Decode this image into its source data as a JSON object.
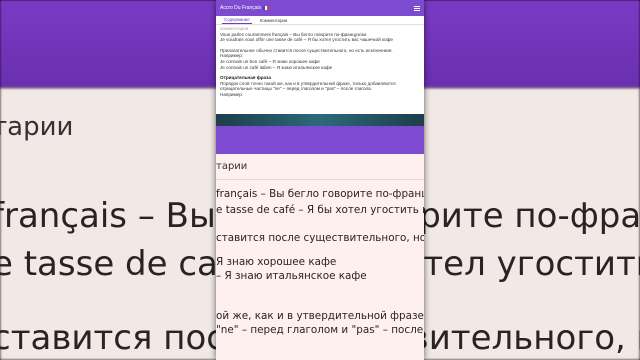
{
  "background": {
    "line1": "тарии",
    "line2": "français – Вы бегло говорите по-французски",
    "line3": "e tasse de café – Я бы хотел угостить вас",
    "line4": "ставится после существительного, но ест"
  },
  "app": {
    "title": "Accro Du Français"
  },
  "tabs": [
    {
      "label": "Содержание"
    },
    {
      "label": "Комментарии"
    }
  ],
  "small_content": {
    "line0": "комментарии",
    "line1": "Vous parlez couramment français – Вы бегло говорите по-французски",
    "line2": "Je voudrais vous offrir une tasse de café – Я бы хотел угостить вас чашечкой кофе",
    "line3": "Прилагательное обычно ставится после существительного, но есть исключения.",
    "line4": "Например:",
    "line5": "Je connais un bon café – Я знаю хорошее кафе",
    "line6": "Je connais un café italien – Я знаю итальянское кафе",
    "heading": "Отрицательная фраза",
    "line7": "Порядок слов точно такой же, как и в утвердительной фразе, только добавляются",
    "line8": "отрицательные частицы \"ne\" – перед глаголом и \"pas\" – после глагола.",
    "line9": "Например:"
  },
  "zoom": {
    "tab": "тарии",
    "line1": "français – Вы бегло говорите по-французс",
    "line2": "e tasse de café – Я бы хотел угостить вас",
    "line3": "ставится после существительного, но ест",
    "line4": "Я знаю хорошее кафе",
    "line5": "– Я знаю итальянское кафе",
    "line6": "ой же, как и в утвердительной фразе, тол",
    "line7": "\"ne\" – перед глаголом и \"pas\" – после гл"
  }
}
